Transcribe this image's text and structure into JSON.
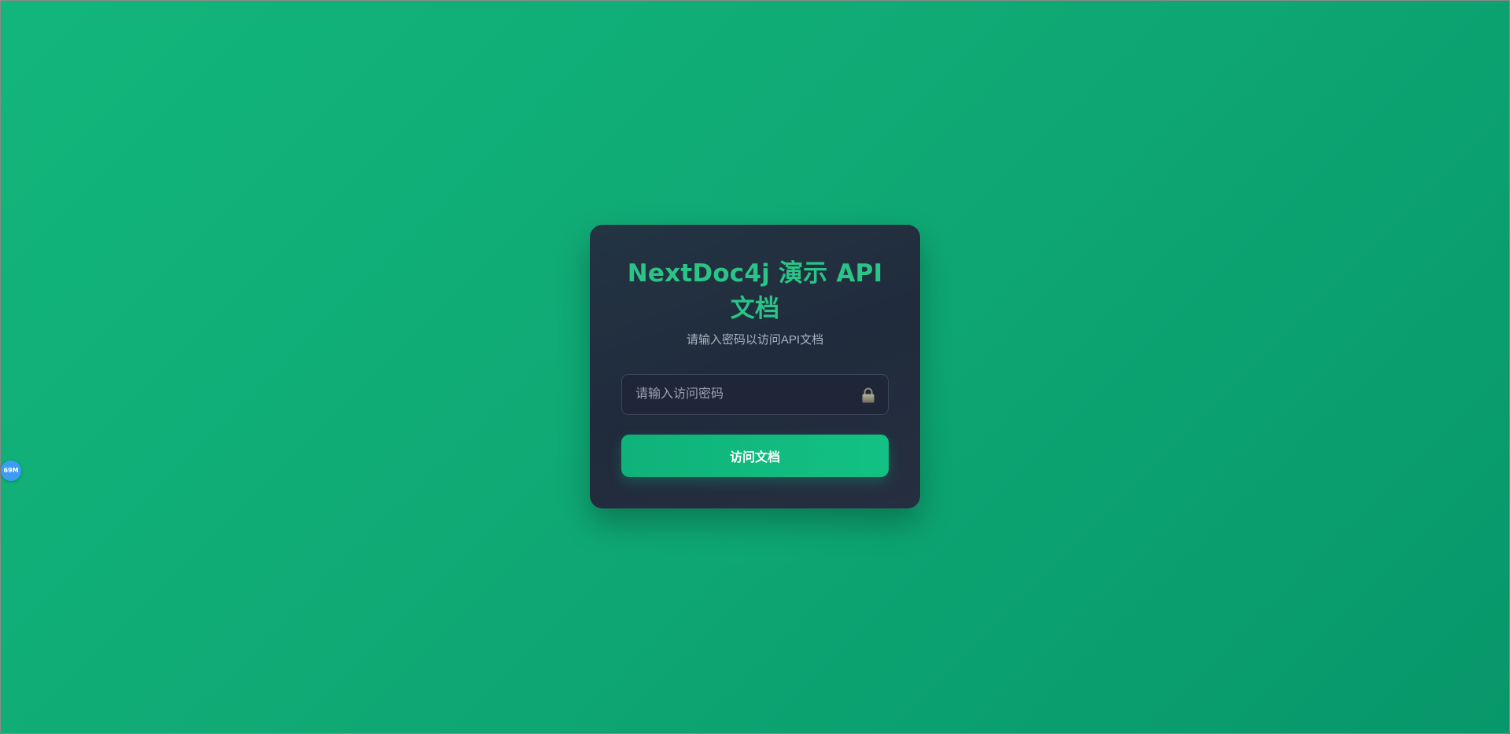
{
  "login": {
    "title": "NextDoc4j 演示 API 文档",
    "subtitle": "请输入密码以访问API文档",
    "password_placeholder": "请输入访问密码",
    "password_value": "",
    "submit_label": "访问文档",
    "lock_icon": "lock-icon"
  },
  "overlay": {
    "memory_badge_label": "69M"
  },
  "colors": {
    "background_start": "#12b67c",
    "background_end": "#07976a",
    "card_background": "#202b3c",
    "title": "#2bc487",
    "button": "#10b981",
    "badge": "#3f9cf3"
  }
}
